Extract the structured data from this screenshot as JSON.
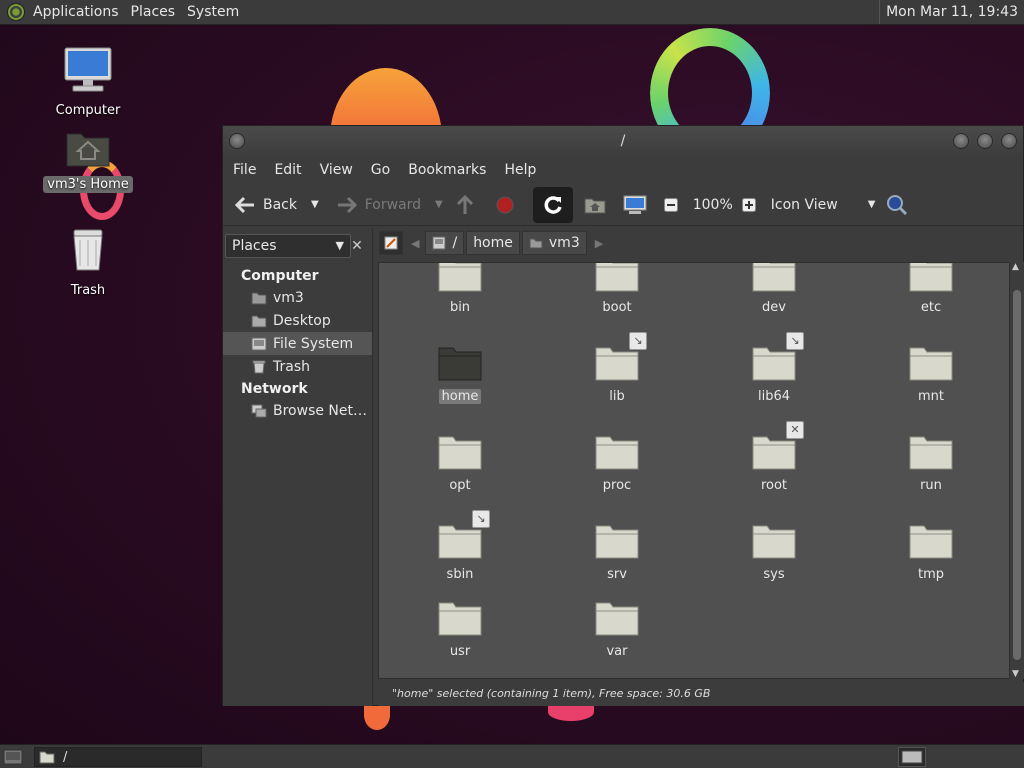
{
  "top_panel": {
    "menus": [
      "Applications",
      "Places",
      "System"
    ],
    "clock": "Mon Mar 11, 19:43"
  },
  "desktop": {
    "icons": [
      {
        "label": "Computer"
      },
      {
        "label": "vm3's Home"
      },
      {
        "label": "Trash"
      }
    ]
  },
  "window": {
    "title": "/",
    "menu": [
      "File",
      "Edit",
      "View",
      "Go",
      "Bookmarks",
      "Help"
    ],
    "toolbar": {
      "back": "Back",
      "forward": "Forward",
      "zoom": "100%",
      "view_mode": "Icon View"
    },
    "sidebar": {
      "selector": "Places",
      "sections": [
        {
          "title": "Computer",
          "items": [
            "vm3",
            "Desktop",
            "File System",
            "Trash"
          ]
        },
        {
          "title": "Network",
          "items": [
            "Browse Net…"
          ]
        }
      ],
      "active_item": "File System"
    },
    "location": {
      "crumbs": [
        "/",
        "home",
        "vm3"
      ]
    },
    "folders": [
      {
        "name": "bin",
        "emblem": "link"
      },
      {
        "name": "boot",
        "emblem": ""
      },
      {
        "name": "dev",
        "emblem": ""
      },
      {
        "name": "etc",
        "emblem": ""
      },
      {
        "name": "home",
        "emblem": "",
        "selected": true
      },
      {
        "name": "lib",
        "emblem": "link"
      },
      {
        "name": "lib64",
        "emblem": "link"
      },
      {
        "name": "mnt",
        "emblem": ""
      },
      {
        "name": "opt",
        "emblem": ""
      },
      {
        "name": "proc",
        "emblem": ""
      },
      {
        "name": "root",
        "emblem": "noaccess"
      },
      {
        "name": "run",
        "emblem": ""
      },
      {
        "name": "sbin",
        "emblem": "link"
      },
      {
        "name": "srv",
        "emblem": ""
      },
      {
        "name": "sys",
        "emblem": ""
      },
      {
        "name": "tmp",
        "emblem": ""
      },
      {
        "name": "usr",
        "emblem": ""
      },
      {
        "name": "var",
        "emblem": ""
      }
    ],
    "status": "\"home\" selected (containing 1 item), Free space: 30.6 GB"
  },
  "bottom_panel": {
    "task_label": "/"
  },
  "colors": {
    "folder_fill": "#d8d8cc",
    "folder_selected": "#3a3a36",
    "panel": "#3b3b3b"
  }
}
